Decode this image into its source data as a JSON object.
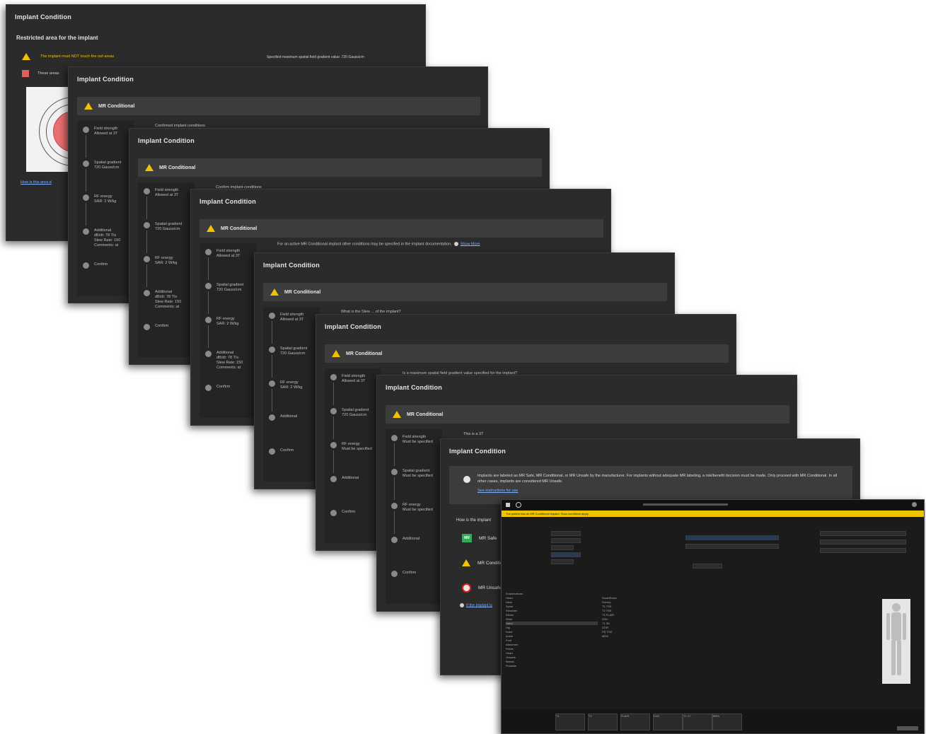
{
  "panels": [
    {
      "title": "Implant Condition",
      "subtitle": "Restricted area for the implant",
      "warning": "The implant must NOT touch the red areas",
      "gradient_note": "Specified maximum spatial field gradient value: 720 Gauss/cm",
      "red_legend": "These areas",
      "link": "How is this area d"
    },
    {
      "title": "Implant Condition",
      "condition": "MR Conditional",
      "hint": "Confirmed implant conditions",
      "steps": [
        {
          "label": "Field strength",
          "value": "Allowed at 3T"
        },
        {
          "label": "Spatial gradient",
          "value": "720 Gauss/cm"
        },
        {
          "label": "RF energy",
          "value": "SAR: 2 W/kg"
        },
        {
          "label": "Additional",
          "value": "dB/dt: 78 T/s\nSlew Rate: 150\nComments: at"
        },
        {
          "label": "Confirm",
          "value": ""
        }
      ]
    },
    {
      "title": "Implant Condition",
      "condition": "MR Conditional",
      "hint": "Confirm implant conditions",
      "steps": [
        {
          "label": "Field strength",
          "value": "Allowed at 3T"
        },
        {
          "label": "Spatial gradient",
          "value": "720 Gauss/cm"
        },
        {
          "label": "RF energy",
          "value": "SAR: 2 W/kg"
        },
        {
          "label": "Additional",
          "value": "dB/dt: 78 T/s\nSlew Rate: 150\nComments: at"
        },
        {
          "label": "Confirm",
          "value": ""
        }
      ]
    },
    {
      "title": "Implant Condition",
      "condition": "MR Conditional",
      "hint": "For an active MR Conditional implant other conditions may be specified in the implant documentation.",
      "hint_link": "Show More",
      "steps": [
        {
          "label": "Field strength",
          "value": "Allowed at 3T"
        },
        {
          "label": "Spatial gradient",
          "value": "720 Gauss/cm"
        },
        {
          "label": "RF energy",
          "value": "SAR: 2 W/kg"
        },
        {
          "label": "Additional",
          "value": "dB/dt: 78 T/s\nSlew Rate: 150\nComments: at"
        },
        {
          "label": "Confirm",
          "value": ""
        }
      ]
    },
    {
      "title": "Implant Condition",
      "condition": "MR Conditional",
      "hint": "What is the Slew ... of the implant?",
      "steps": [
        {
          "label": "Field strength",
          "value": "Allowed at 3T"
        },
        {
          "label": "Spatial gradient",
          "value": "720 Gauss/cm"
        },
        {
          "label": "RF energy",
          "value": "SAR: 2 W/kg"
        },
        {
          "label": "Additional",
          "value": ""
        },
        {
          "label": "Confirm",
          "value": ""
        }
      ]
    },
    {
      "title": "Implant Condition",
      "condition": "MR Conditional",
      "hint": "Is a maximum spatial field gradient value specified for the implant?",
      "steps": [
        {
          "label": "Field strength",
          "value": "Allowed at 3T"
        },
        {
          "label": "Spatial gradient",
          "value": "720 Gauss/cm"
        },
        {
          "label": "RF energy",
          "value": "Must be specified"
        },
        {
          "label": "Additional",
          "value": ""
        },
        {
          "label": "Confirm",
          "value": ""
        }
      ]
    },
    {
      "title": "Implant Condition",
      "condition": "MR Conditional",
      "hint": "This is a 3T",
      "steps": [
        {
          "label": "Field strength",
          "value": "Must be specified"
        },
        {
          "label": "Spatial gradient",
          "value": "Must be specified"
        },
        {
          "label": "RF energy",
          "value": "Must be specified"
        },
        {
          "label": "Additional",
          "value": ""
        },
        {
          "label": "Confirm",
          "value": ""
        }
      ]
    },
    {
      "title": "Implant Condition",
      "info": "Implants are labeled as MR Safe, MR Conditional, or MR Unsafe by the manufacturer. For implants without adequate MR labeling, a risk/benefit decision must be made. Only proceed with MR Conditional. In all other cases, implants are considered MR Unsafe.",
      "info_link": "See instructions for use",
      "question": "How is the implant",
      "options": [
        "MR Safe",
        "MR Conditional",
        "MR Unsafe"
      ],
      "more": "If the implant is"
    }
  ],
  "workstation": {
    "yellow_bar": "The patient has an MR Conditional implant. Scan conditions apply.",
    "tree": [
      "Examinations",
      "Head",
      "Neck",
      "Spine",
      "Shoulder",
      "Elbow",
      "Wrist",
      "Hand",
      "Hip",
      "Knee",
      "Ankle",
      "Foot",
      "Abdomen",
      "Pelvis",
      "Heart",
      "Vessels",
      "Breast",
      "Prostate"
    ],
    "list": [
      "SmartExam",
      "Survey",
      "T1 TSE",
      "T2 TSE",
      "T2 FLAIR",
      "DWI",
      "T1 3D",
      "STIR",
      "PD TSE",
      "MRA"
    ],
    "slots": [
      "T1",
      "T2",
      "FLAIR",
      "DWI",
      "T1 C+",
      "MRA"
    ]
  }
}
